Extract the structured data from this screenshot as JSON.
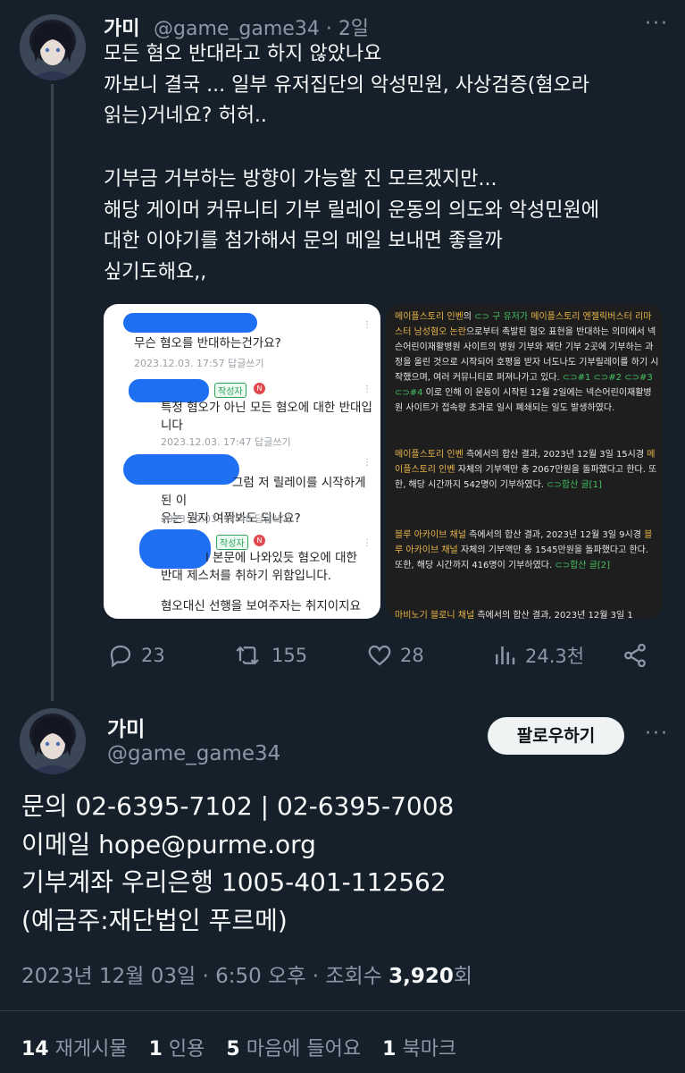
{
  "reply": {
    "name": "가미",
    "handle": "@game_game34",
    "time": "· 2일",
    "more": "···",
    "text1": "모든 혐오 반대라고 하지 않았나요\n까보니 결국 ... 일부 유저집단의 악성민원, 사상검증(혐오라\n읽는)거네요? 허허..",
    "text2": "기부금 거부하는 방향이 가능할 진 모르겠지만...\n해당 게이머 커뮤니티 기부 릴레이 운동의 의도와 악성민원에\n대한 이야기를 첨가해서 문의 메일 보내면 좋을까\n싶기도해요,,",
    "left_card": {
      "q1": "무슨 혐오를 반대하는건가요?",
      "q1_meta": "2023.12.03. 17:57   답글쓰기",
      "author_badge": "작성자",
      "n_badge": "N",
      "a1": "특정 혐오가 아닌 모든 혐오에 대한 반대입\n니다",
      "a1_meta": "2023.12.03. 17:47   답글쓰기",
      "q2": "그럼 저 릴레이를 시작하게 된 이\n유는 뭔지 여쭤봐도 되나요?",
      "q2_meta": "2023.12.03. 17:48   답글쓰기",
      "a2": "l 본문에 나와있듯 혐오에 대한\n반대 제스처를 취하기 위함입니다.",
      "a2_tail": "혐오대신 선행을 보여주자는 취지이지요"
    },
    "right_card": {
      "p1": [
        {
          "t": "메이플스토리 인벤",
          "c": "hl"
        },
        {
          "t": "의 ",
          "c": ""
        },
        {
          "t": "⊂⊃ 구 유저가 ",
          "c": "lk"
        },
        {
          "t": "메이플스토리 엔젤릭버스터",
          "c": "hl"
        },
        {
          "t": " ",
          "c": ""
        },
        {
          "t": "리마스터 남성혐오 논란",
          "c": "hl"
        },
        {
          "t": "으로부터 촉발된 혐오 표현을 반대하는 의미에서 넥슨어린이재활병원 사이트의 병원 기부와 재단 기부 2곳에 기부하는 과정을 올린 것으로 시작되어 호평을 받자 너도나도 기부릴레이를 하기 시작했으며, 여러 커뮤니티로 퍼져나가고 있다. ",
          "c": ""
        },
        {
          "t": "⊂⊃#1 ⊂⊃#2 ⊂⊃#3 ⊂⊃#4",
          "c": "lk"
        },
        {
          "t": " 이로 인해 이 운동이 시작된 12월 2일에는 넥슨어린이재활병원 사이트가 접속량 초과로 일시 폐쇄되는 일도 발생하였다.",
          "c": ""
        }
      ],
      "p2": [
        {
          "t": "메이플스토리 인벤",
          "c": "hl"
        },
        {
          "t": " 측에서의 합산 결과, 2023년 12월 3일 15시경 ",
          "c": ""
        },
        {
          "t": "메이플스토리 인벤",
          "c": "hl"
        },
        {
          "t": " 자체의 기부액만 총 2067만원을 돌파했다고 한다. 또한, 해당 시간까지 542명이 기부하였다. ",
          "c": ""
        },
        {
          "t": "⊂⊃합산 글[1]",
          "c": "lk"
        }
      ],
      "p3": [
        {
          "t": "블루 아카이브 채널",
          "c": "hl"
        },
        {
          "t": " 측에서의 합산 결과, 2023년 12월 3일 9시경 ",
          "c": ""
        },
        {
          "t": "블루 아카이브 채널",
          "c": "hl"
        },
        {
          "t": " 자체의 기부액만 총 1545만원을 돌파했다고 한다. 또한, 해당 시간까지 416명이 기부하였다. ",
          "c": ""
        },
        {
          "t": "⊂⊃합산 글[2]",
          "c": "lk"
        }
      ],
      "p4": [
        {
          "t": "마비노기 블로니 채널",
          "c": "hl"
        },
        {
          "t": " 측에서의 합산 결과, 2023년 12월 3일 1",
          "c": ""
        }
      ]
    },
    "actions": {
      "replies": "23",
      "retweets": "155",
      "likes": "28",
      "views": "24.3천"
    }
  },
  "main": {
    "name": "가미",
    "handle": "@game_game34",
    "follow_label": "팔로우하기",
    "more": "···",
    "line1": "문의 02-6395-7102 | 02-6395-7008",
    "line2": "이메일 hope@purme.org",
    "line3": "기부계좌 우리은행 1005-401-112562",
    "line4": "(예금주:재단법인 푸르메)",
    "date": "2023년 12월 03일 · 6:50 오후 · 조회수 ",
    "views": "3,920",
    "views_unit": "회",
    "stats": {
      "retweets_count": "14",
      "retweets_label": "재게시물",
      "quotes_count": "1",
      "quotes_label": "인용",
      "likes_count": "5",
      "likes_label": "마음에 들어요",
      "bookmarks_count": "1",
      "bookmarks_label": "북마크"
    }
  },
  "colors": {
    "background": "#15202b",
    "text": "#f7f9f9",
    "muted": "#8b98a5",
    "scribble": "#1f6ff2",
    "highlight": "#e8b54a",
    "link_green": "#43c061"
  }
}
